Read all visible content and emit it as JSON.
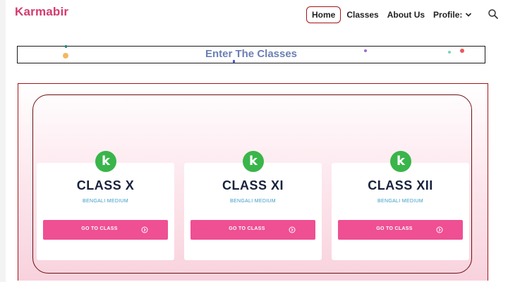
{
  "brand": "Karmabir",
  "nav": {
    "home": "Home",
    "classes": "Classes",
    "about": "About Us",
    "profile": "Profile:"
  },
  "banner": {
    "title": "Enter The Classes"
  },
  "cards": [
    {
      "badge": "k",
      "title": "CLASS X",
      "medium": "BENGALI MEDIUM",
      "button": "GO TO CLASS"
    },
    {
      "badge": "k",
      "title": "CLASS XI",
      "medium": "BENGALI MEDIUM",
      "button": "GO TO CLASS"
    },
    {
      "badge": "k",
      "title": "CLASS XII",
      "medium": "BENGALI MEDIUM",
      "button": "GO TO CLASS"
    }
  ],
  "colors": {
    "brand": "#d33b6e",
    "button": "#ef4f93",
    "badge": "#3ab54a",
    "accent_border": "#a31515"
  },
  "icons": {
    "profile_dropdown": "chevron-down-icon",
    "search": "search-icon",
    "badge": "k-logo-icon",
    "button": "arrow-circle-right-icon"
  }
}
